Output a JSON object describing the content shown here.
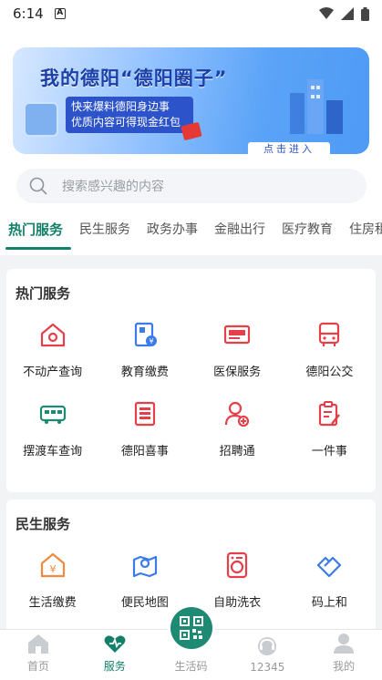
{
  "status_bar": {
    "time": "6:14"
  },
  "banner": {
    "title": "我的德阳“德阳圈子”",
    "subtitle_line1": "快来爆料德阳身边事",
    "subtitle_line2": "优质内容可得现金红包",
    "enter_label": "点击进入"
  },
  "search": {
    "placeholder": "搜索感兴趣的内容"
  },
  "tabs": [
    {
      "label": "热门服务",
      "active": true
    },
    {
      "label": "民生服务"
    },
    {
      "label": "政务办事"
    },
    {
      "label": "金融出行"
    },
    {
      "label": "医疗教育"
    },
    {
      "label": "住房租"
    }
  ],
  "hot_services": {
    "title": "热门服务",
    "items": [
      {
        "label": "不动产查询",
        "icon": "house-icon"
      },
      {
        "label": "教育缴费",
        "icon": "education-payment-icon"
      },
      {
        "label": "医保服务",
        "icon": "medical-insurance-card-icon"
      },
      {
        "label": "德阳公交",
        "icon": "bus-icon"
      },
      {
        "label": "摆渡车查询",
        "icon": "shuttle-bus-icon"
      },
      {
        "label": "德阳喜事",
        "icon": "wedding-icon"
      },
      {
        "label": "招聘通",
        "icon": "recruitment-icon"
      },
      {
        "label": "一件事",
        "icon": "checklist-icon"
      }
    ]
  },
  "livelihood_services": {
    "title": "民生服务",
    "items": [
      {
        "label": "生活缴费",
        "icon": "utility-payment-icon"
      },
      {
        "label": "便民地图",
        "icon": "map-icon"
      },
      {
        "label": "自助洗衣",
        "icon": "washing-machine-icon"
      },
      {
        "label": "码上和",
        "icon": "handshake-icon"
      }
    ]
  },
  "bottom_nav": [
    {
      "label": "首页",
      "icon": "home-icon"
    },
    {
      "label": "服务",
      "icon": "service-icon",
      "active": true
    },
    {
      "label": "生活码",
      "icon": "qr-code-icon"
    },
    {
      "label": "12345",
      "icon": "hotline-icon"
    },
    {
      "label": "我的",
      "icon": "profile-icon"
    }
  ],
  "colors": {
    "accent": "#13806a",
    "icon_red": "#e5404a",
    "icon_green": "#1f8a73",
    "icon_orange": "#f08a3c",
    "icon_blue": "#3c7be8"
  }
}
